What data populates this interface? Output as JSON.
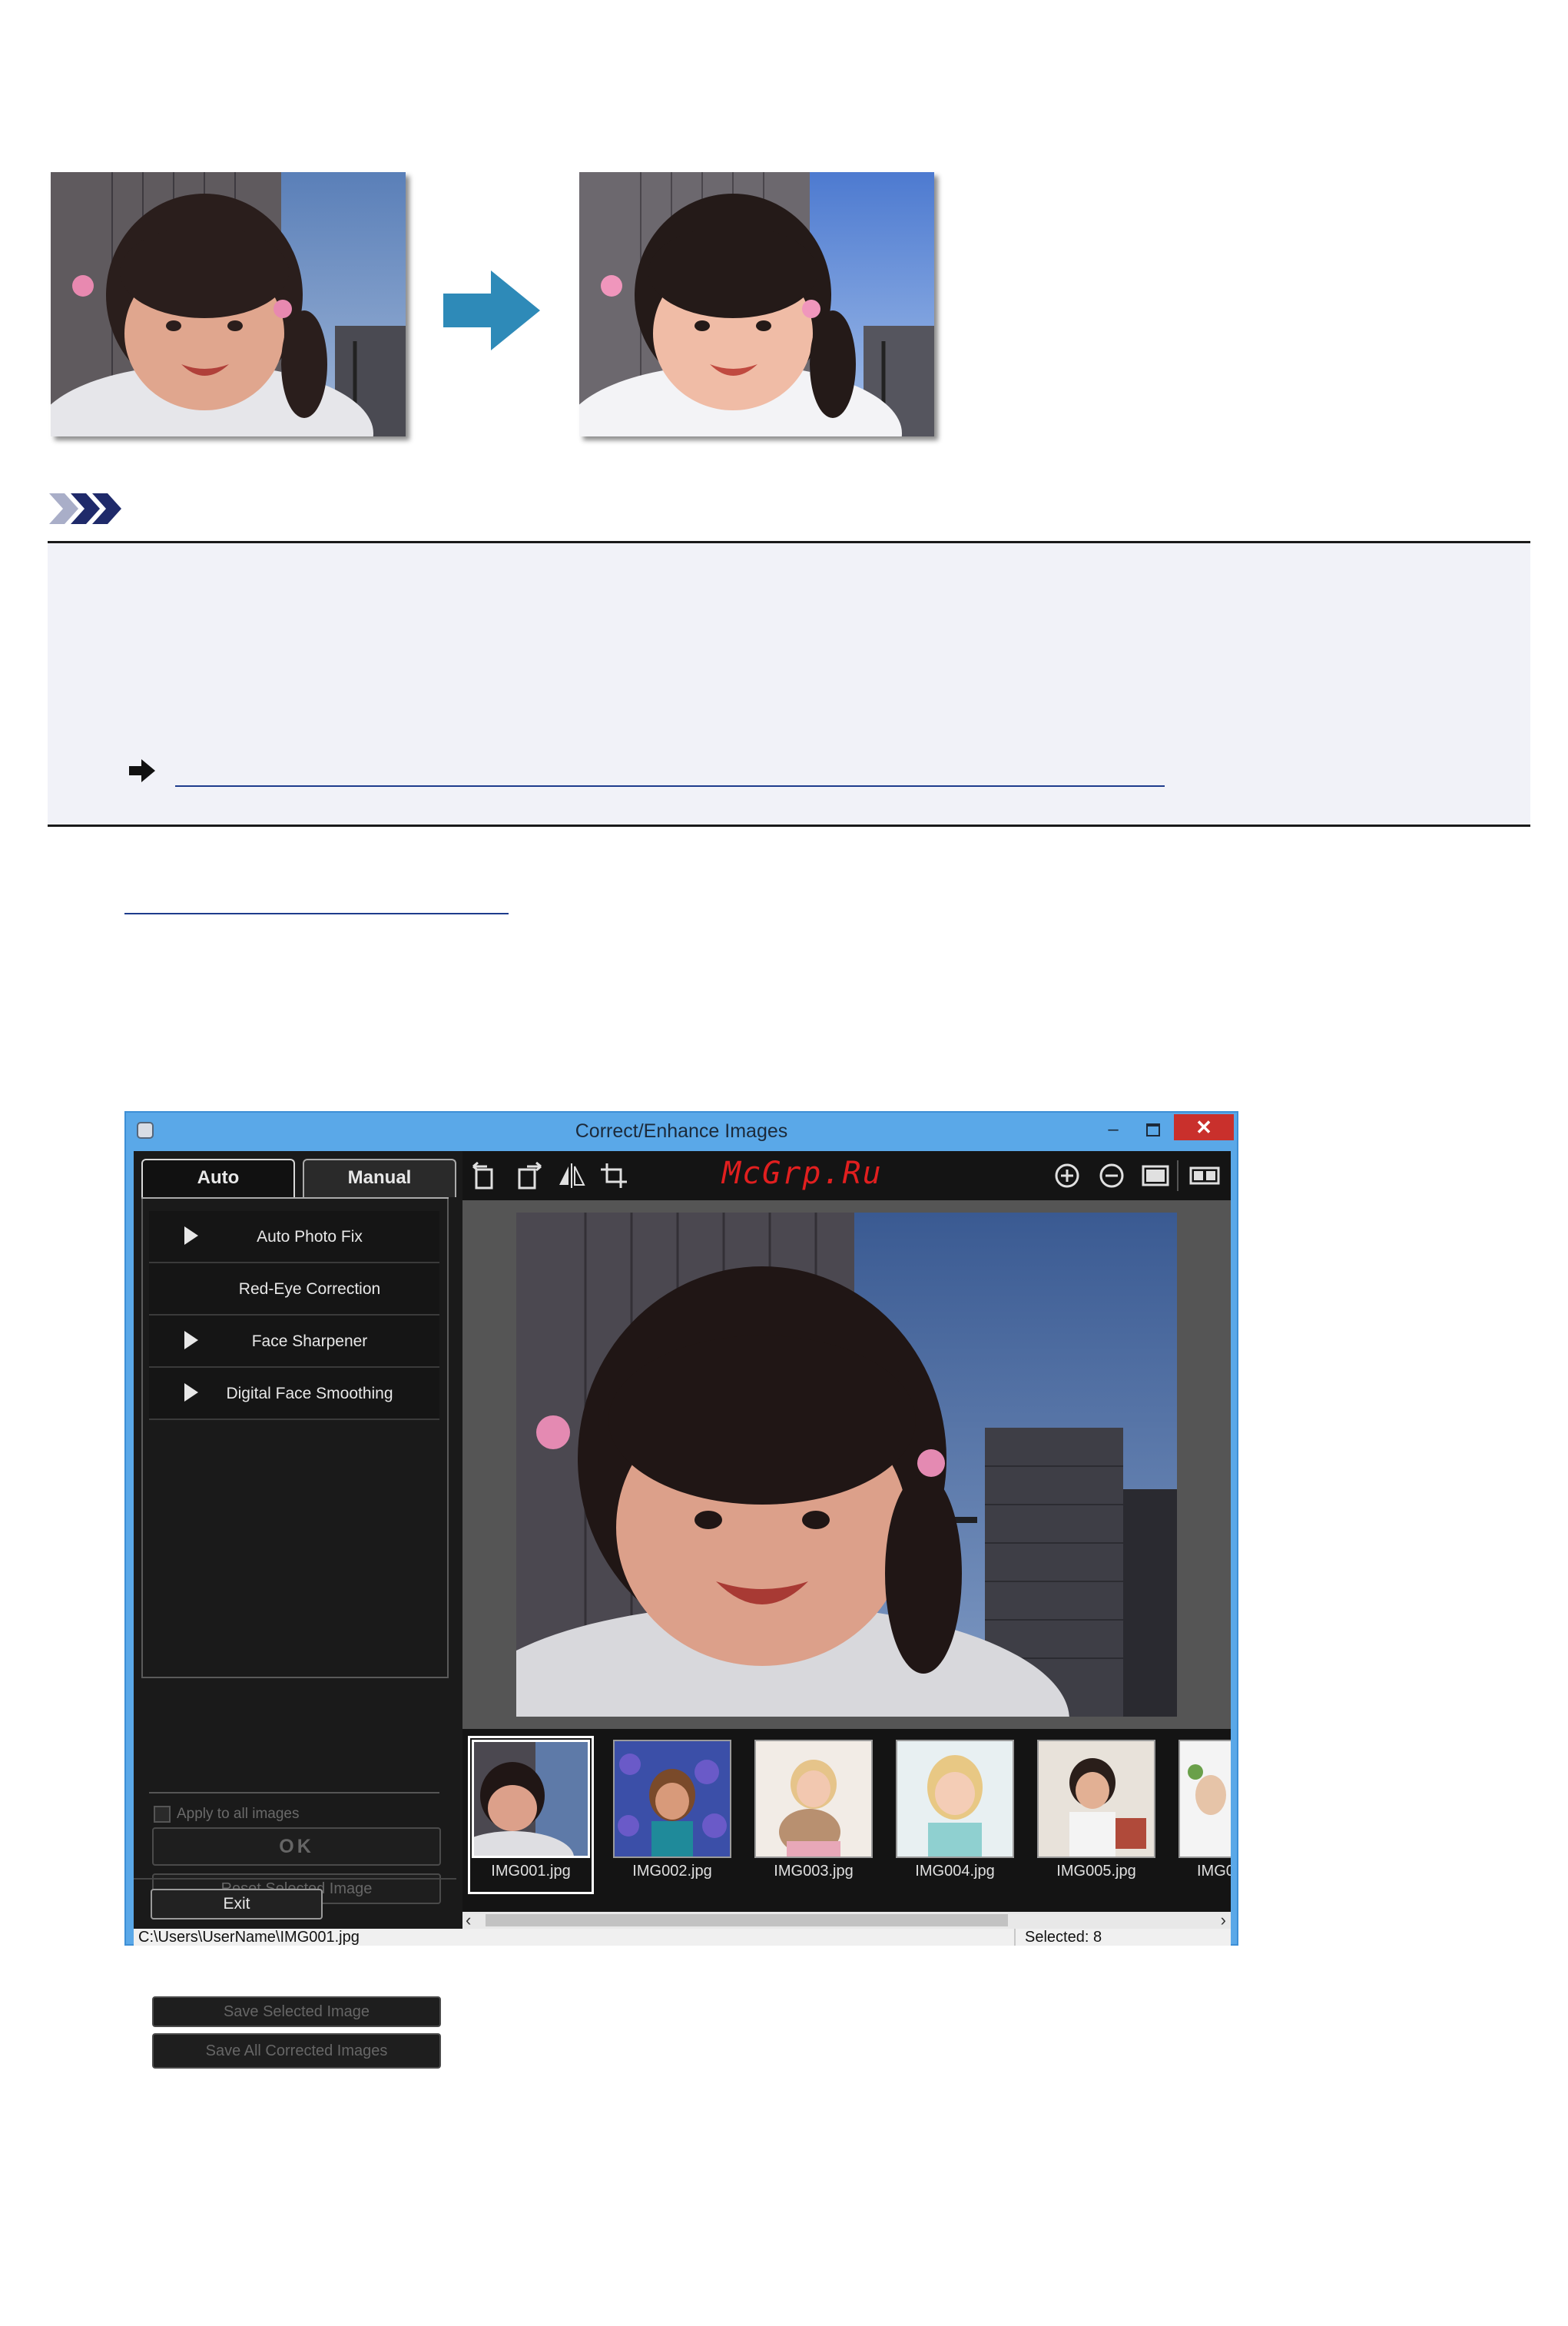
{
  "window": {
    "title": "Correct/Enhance Images",
    "minimize": "–",
    "close": "✕"
  },
  "tabs": {
    "auto": "Auto",
    "manual": "Manual"
  },
  "corrections": [
    {
      "label": "Auto Photo Fix"
    },
    {
      "label": "Red-Eye Correction"
    },
    {
      "label": "Face Sharpener"
    },
    {
      "label": "Digital Face Smoothing"
    }
  ],
  "options": {
    "apply_all": "Apply to all images",
    "ok": "OK",
    "reset": "Reset Selected Image",
    "save_selected": "Save Selected Image",
    "save_all": "Save All Corrected Images",
    "exit": "Exit"
  },
  "toolbar": {
    "icons": [
      "rotate-left-icon",
      "rotate-right-icon",
      "flip-icon",
      "crop-icon",
      "zoom-in-icon",
      "zoom-out-icon",
      "full-screen-icon",
      "compare-icon"
    ]
  },
  "watermark": "McGrp.Ru",
  "thumbnails": [
    {
      "name": "IMG001.jpg",
      "selected": true
    },
    {
      "name": "IMG002.jpg"
    },
    {
      "name": "IMG003.jpg"
    },
    {
      "name": "IMG004.jpg"
    },
    {
      "name": "IMG005.jpg"
    },
    {
      "name": "IMG0"
    }
  ],
  "status": {
    "path": "C:\\Users\\UserName\\IMG001.jpg",
    "selected": "Selected: 8"
  },
  "colors": {
    "accent_arrow": "#2e8ab8",
    "title_bar": "#5aa8e8",
    "close_button": "#c9302c",
    "note_background": "#f1f2f8",
    "link": "#1e3c8c"
  }
}
